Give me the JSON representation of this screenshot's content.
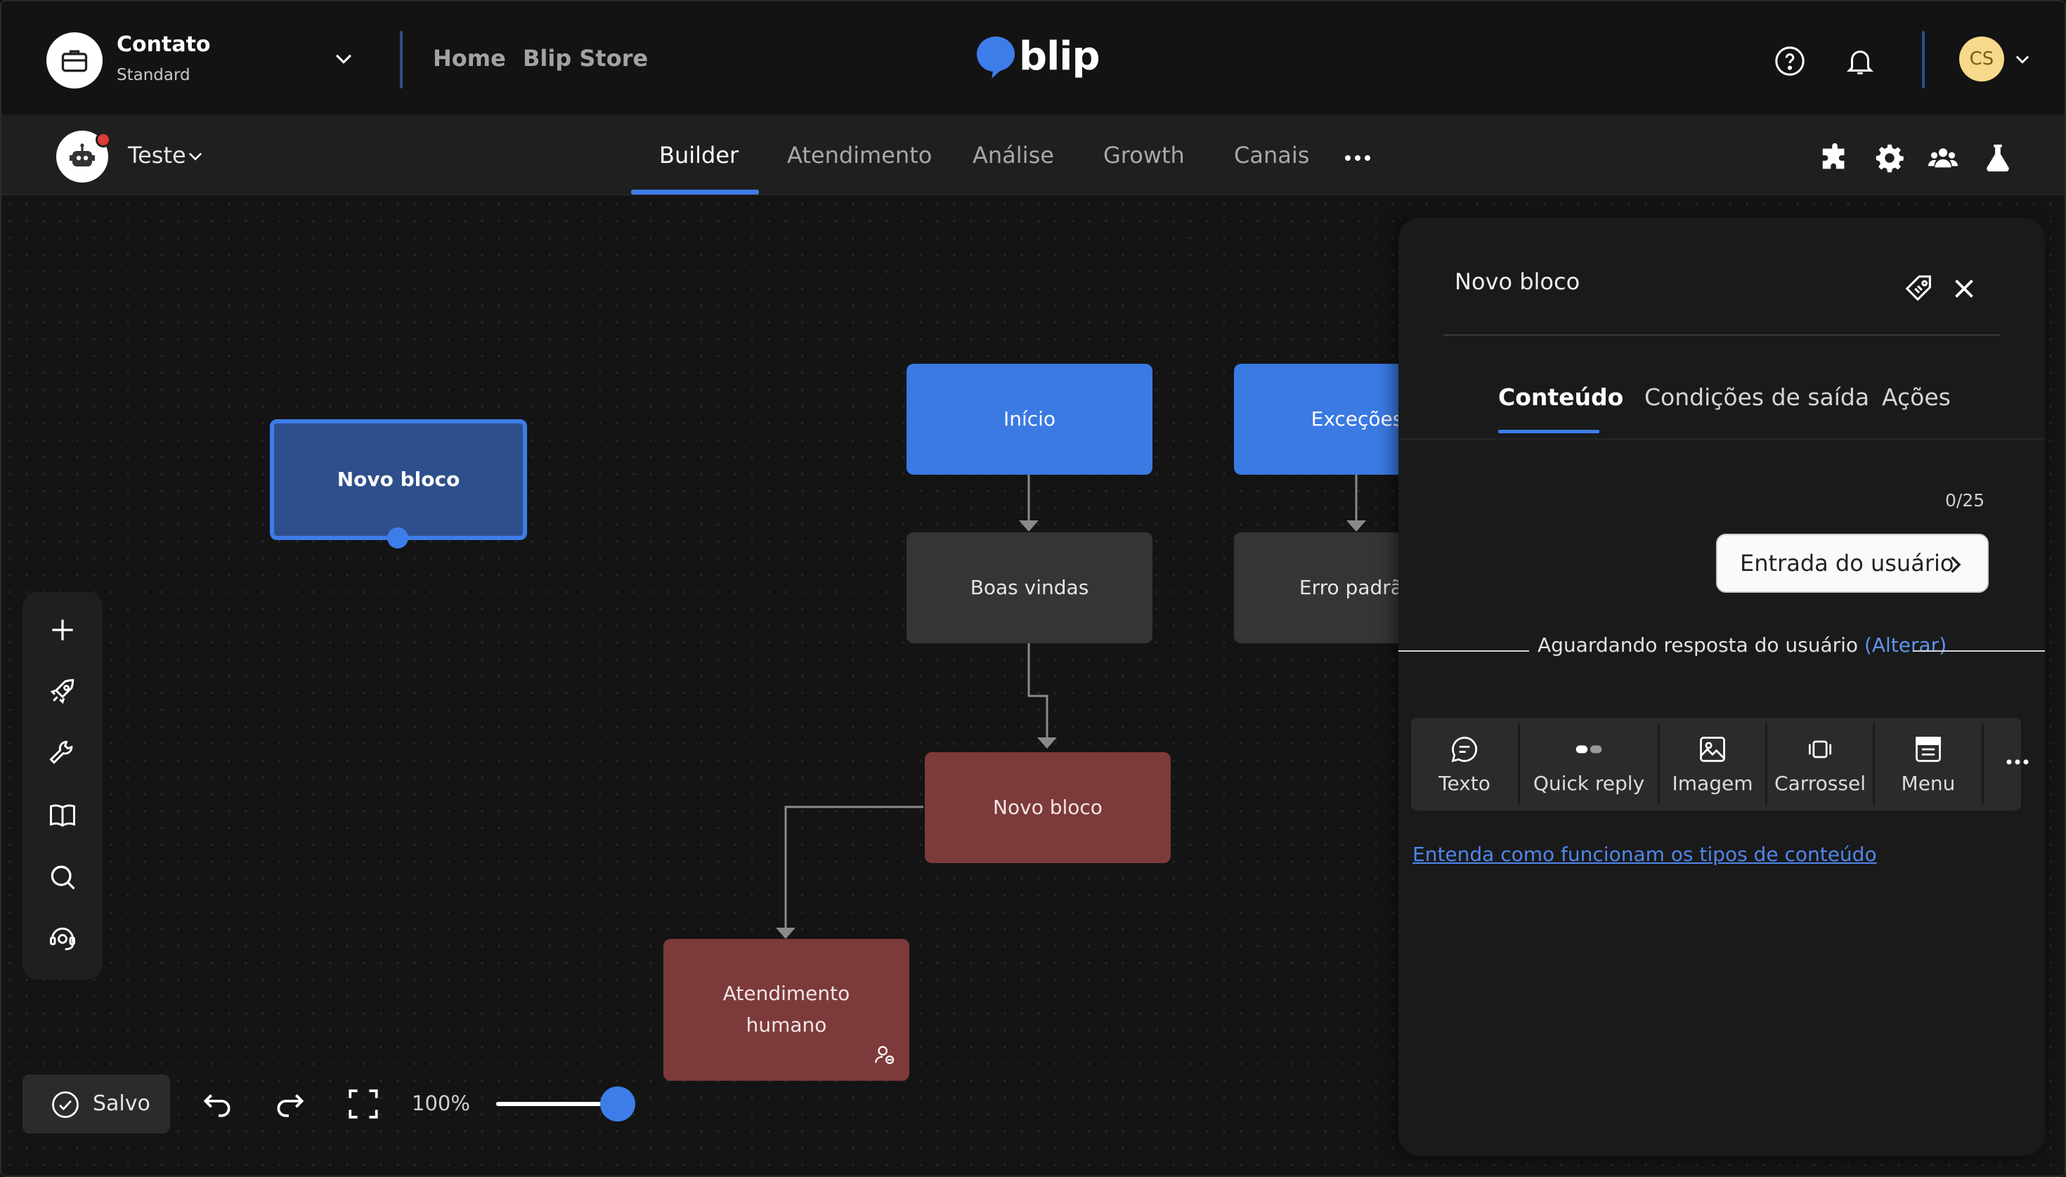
{
  "header": {
    "account_name": "Contato",
    "account_plan": "Standard",
    "nav": [
      "Home",
      "Blip Store"
    ],
    "logo_text": "blip",
    "user_initials": "CS"
  },
  "subheader": {
    "bot_name": "Teste",
    "tabs": [
      "Builder",
      "Atendimento",
      "Análise",
      "Growth",
      "Canais"
    ],
    "active_tab": "Builder"
  },
  "canvas": {
    "nodes": {
      "novo_bloco_selected": "Novo bloco",
      "inicio": "Início",
      "excecoes": "Exceções",
      "boas_vindas": "Boas vindas",
      "erro_padrao": "Erro padrão",
      "novo_bloco": "Novo bloco",
      "atendimento_humano": "Atendimento humano"
    },
    "saved_label": "Salvo",
    "zoom_label": "100%",
    "zoom_level": 100
  },
  "panel": {
    "title": "Novo bloco",
    "tabs": [
      "Conteúdo",
      "Condições de saída",
      "Ações"
    ],
    "active_tab": "Conteúdo",
    "char_counter": "0/25",
    "user_input_button": "Entrada do usuário",
    "waiting_text": "Aguardando resposta do usuário",
    "waiting_link": "(Alterar)",
    "content_types": [
      "Texto",
      "Quick reply",
      "Imagem",
      "Carrossel",
      "Menu"
    ],
    "help_link": "Entenda como funcionam os tipos de conteúdo"
  },
  "colors": {
    "accent": "#3d7de9",
    "block_blue": "#3a7ae2",
    "block_red": "#7d3a3a",
    "block_gray": "#353535"
  }
}
